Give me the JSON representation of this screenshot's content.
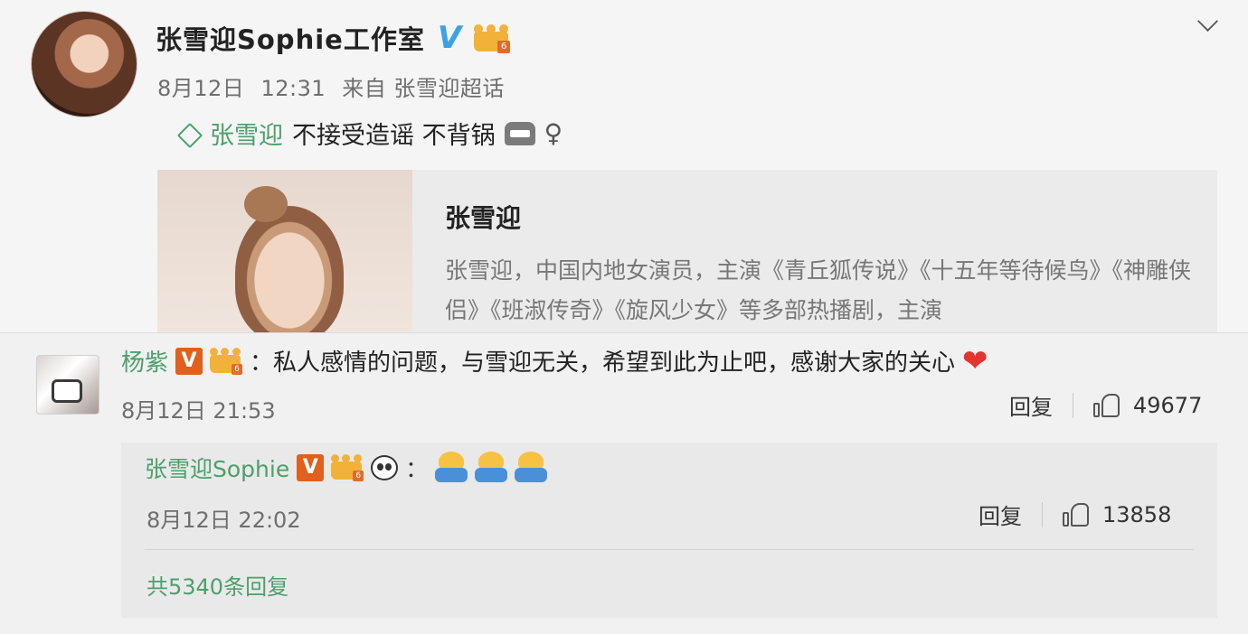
{
  "post": {
    "author": "张雪迎Sophie工作室",
    "verified_mark": "V",
    "meta": {
      "date": "8月12日",
      "time": "12:31",
      "source": "来自 张雪迎超话"
    },
    "topic": "张雪迎",
    "text": "不接受造谣 不背锅",
    "female_sign": "♀",
    "card": {
      "title": "张雪迎",
      "description": "张雪迎，中国内地女演员，主演《青丘狐传说》《十五年等待候鸟》《神雕侠侣》《班淑传奇》《旋风少女》等多部热播剧，主演"
    }
  },
  "comment": {
    "user": "杨紫",
    "badge_v": "V",
    "text": "：私人感情的问题，与雪迎无关，希望到此为止吧，感谢大家的关心",
    "heart": "❤",
    "time": "8月12日 21:53",
    "reply_label": "回复",
    "likes": "49677",
    "reply": {
      "user": "张雪迎Sophie",
      "badge_v": "V",
      "colon": "：",
      "time": "8月12日 22:02",
      "reply_label": "回复",
      "likes": "13858"
    },
    "total_replies": "共5340条回复"
  },
  "icons": [
    "chevron-down-icon",
    "verified-icon",
    "member-crown-icon",
    "topic-icon",
    "grin-emoji-icon",
    "panda-emoji-icon",
    "doge-emoji-icon",
    "heart-emoji-icon",
    "thumbs-up-icon"
  ],
  "colors": {
    "link_green": "#4ca069",
    "verified_blue": "#3aa2e8",
    "badge_orange": "#e0601c",
    "heart_red": "#e3342f"
  }
}
